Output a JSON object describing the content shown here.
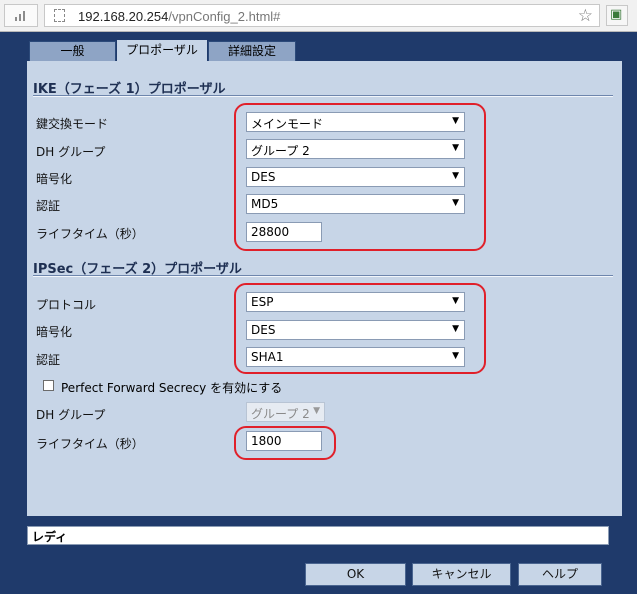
{
  "browser": {
    "url_host": "192.168.20.254",
    "url_path": "/vpnConfig_2.html#"
  },
  "tabs": [
    {
      "label": "一般"
    },
    {
      "label": "プロポーザル"
    },
    {
      "label": "詳細設定"
    }
  ],
  "ike": {
    "title": "IKE（フェーズ 1）プロポーザル",
    "key_exchange_label": "鍵交換モード",
    "key_exchange_value": "メインモード",
    "dh_group_label": "DH グループ",
    "dh_group_value": "グループ 2",
    "encryption_label": "暗号化",
    "encryption_value": "DES",
    "auth_label": "認証",
    "auth_value": "MD5",
    "lifetime_label": "ライフタイム（秒）",
    "lifetime_value": "28800"
  },
  "ipsec": {
    "title": "IPSec（フェーズ 2）プロポーザル",
    "protocol_label": "プロトコル",
    "protocol_value": "ESP",
    "encryption_label": "暗号化",
    "encryption_value": "DES",
    "auth_label": "認証",
    "auth_value": "SHA1",
    "pfs_label": "Perfect Forward Secrecy を有効にする",
    "dh_group_label": "DH グループ",
    "dh_group_value": "グループ 2",
    "lifetime_label": "ライフタイム（秒）",
    "lifetime_value": "1800"
  },
  "status": {
    "text": "レディ"
  },
  "buttons": {
    "ok": "OK",
    "cancel": "キャンセル",
    "help": "ヘルプ"
  },
  "colors": {
    "background": "#1f3a6b",
    "panel": "#c7d5e7",
    "highlight": "#e0202a"
  }
}
